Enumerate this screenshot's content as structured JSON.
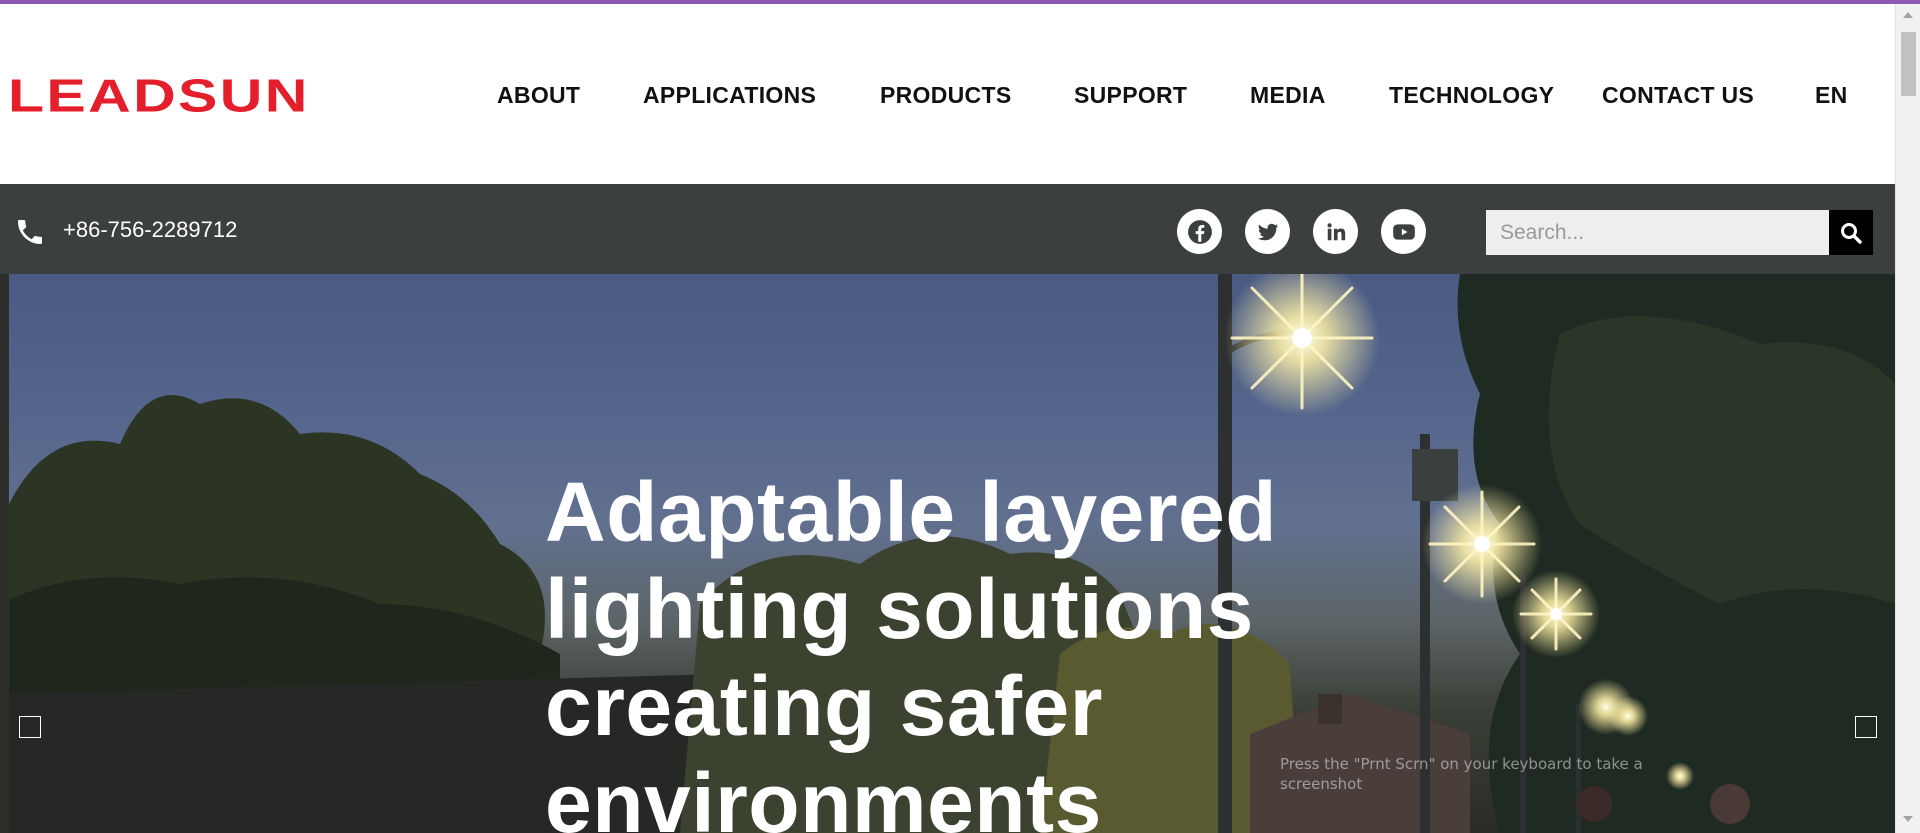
{
  "brand": {
    "logo_text": "LEADSUN",
    "logo_color": "#e41e2b",
    "accent_color": "#8e59b0"
  },
  "nav": {
    "items": [
      {
        "label": "ABOUT"
      },
      {
        "label": "APPLICATIONS"
      },
      {
        "label": "PRODUCTS"
      },
      {
        "label": "SUPPORT"
      },
      {
        "label": "MEDIA"
      },
      {
        "label": "TECHNOLOGY"
      },
      {
        "label": "CONTACT US"
      },
      {
        "label": "EN"
      }
    ]
  },
  "info_bar": {
    "background": "#3c3f3f",
    "phone_icon": "phone-icon",
    "phone": "+86-756-2289712",
    "social": [
      {
        "icon": "facebook-icon"
      },
      {
        "icon": "twitter-icon"
      },
      {
        "icon": "linkedin-icon"
      },
      {
        "icon": "youtube-icon"
      }
    ],
    "search": {
      "placeholder": "Search...",
      "value": "",
      "button_icon": "search-icon"
    }
  },
  "hero": {
    "title_lines": [
      "Adaptable layered",
      "lighting solutions",
      "creating safer",
      "environments"
    ],
    "prev_icon": "arrow-left-icon",
    "next_icon": "arrow-right-icon"
  },
  "overlay_toast": {
    "line1": "Press the \"Prnt Scrn\" on your keyboard to take a",
    "line2": "screenshot"
  }
}
